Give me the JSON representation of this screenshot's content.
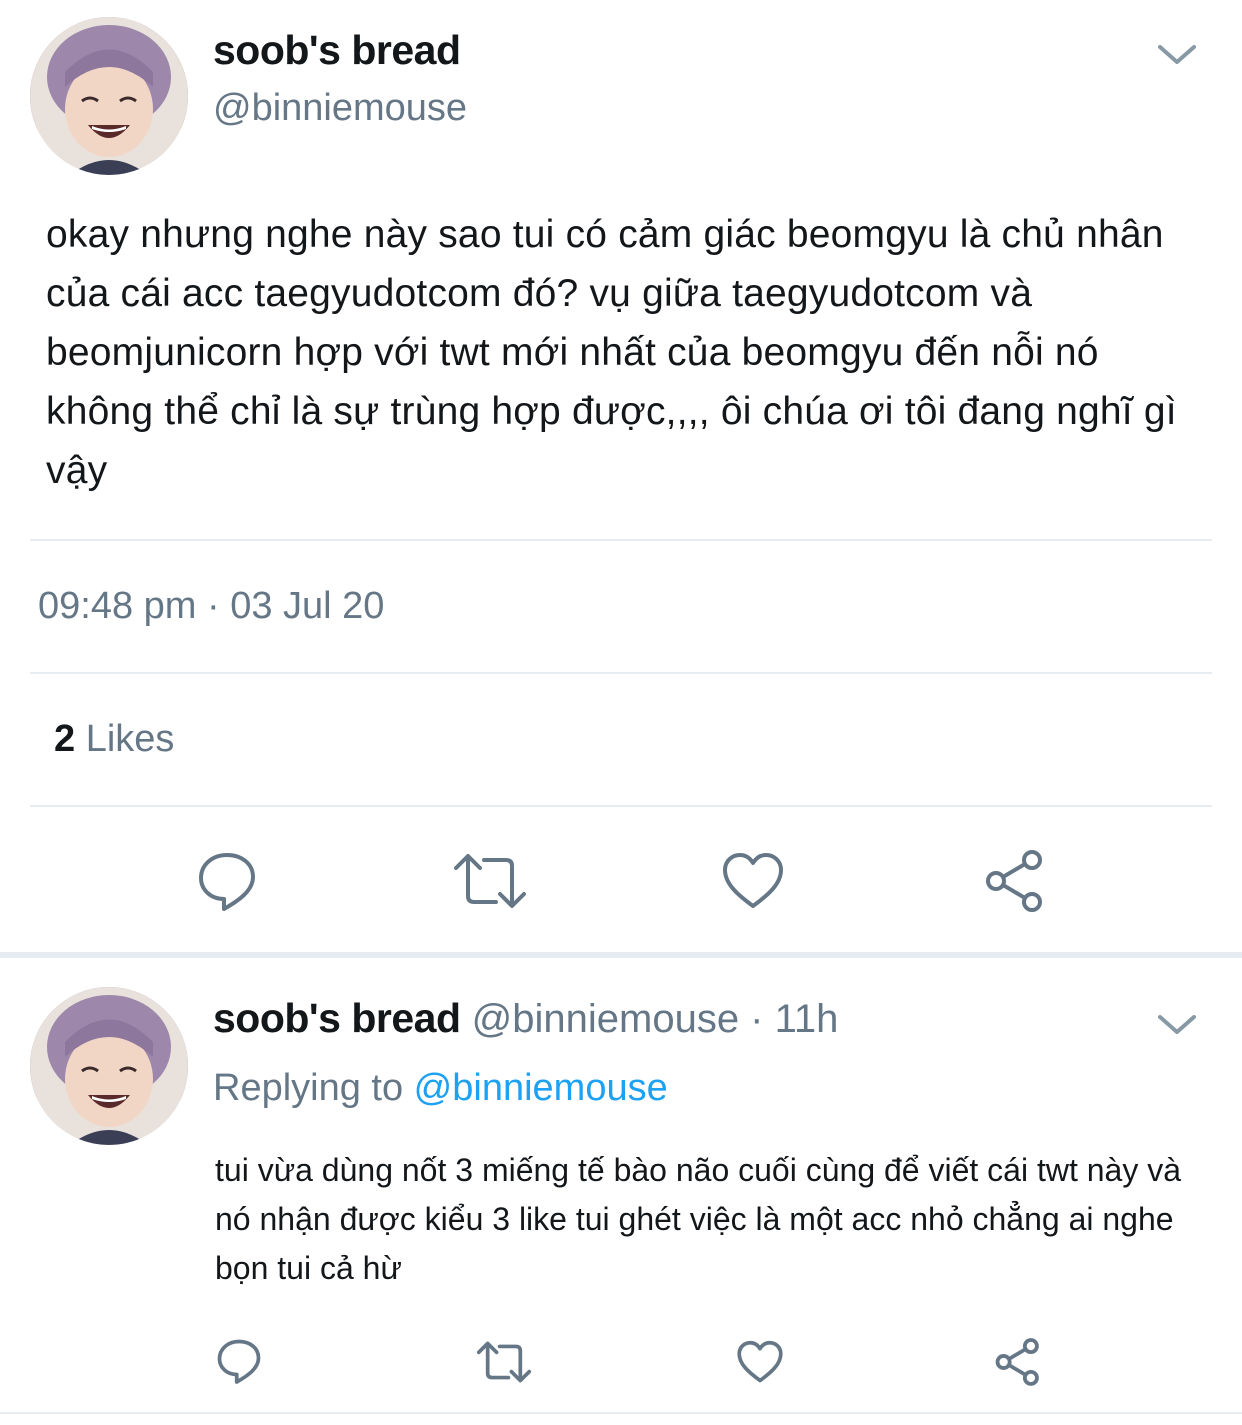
{
  "main_tweet": {
    "display_name": "soob's bread",
    "handle": "@binniemouse",
    "text": "okay nhưng nghe này sao tui có cảm giác beomgyu là chủ nhân của cái acc taegyudotcom đó? vụ giữa taegyudotcom và beomjunicorn hợp với twt mới nhất của beomgyu đến nỗi nó không thể chỉ là sự trùng hợp được,,,, ôi chúa ơi tôi đang nghĩ gì vậy",
    "timestamp": "09:48 pm · 03 Jul 20",
    "likes_count": "2",
    "likes_label": " Likes",
    "actions": [
      "reply-icon",
      "retweet-icon",
      "like-icon",
      "share-icon"
    ]
  },
  "reply_tweet": {
    "display_name": "soob's bread",
    "meta": " @binniemouse · 11h",
    "replying_prefix": "Replying to ",
    "replying_mention": "@binniemouse",
    "text": "tui vừa dùng nốt 3 miếng tế bào não cuối cùng để viết cái twt này và nó nhận được kiểu 3 like tui ghét việc là một acc nhỏ chẳng ai nghe bọn tui cả hừ",
    "actions": [
      "reply-icon",
      "retweet-icon",
      "like-icon",
      "share-icon"
    ]
  },
  "colors": {
    "text_primary": "#14171a",
    "text_secondary": "#657786",
    "link": "#1da1f2",
    "divider": "#e6ecf0",
    "icon": "#657786"
  }
}
